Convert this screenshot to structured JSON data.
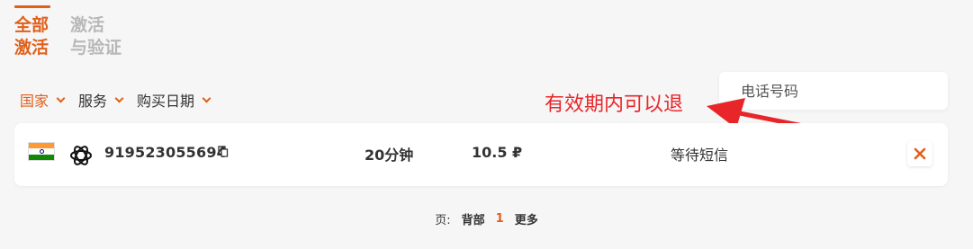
{
  "tabs": [
    {
      "label": "全部\n激活",
      "active": true
    },
    {
      "label": "激活\n与验证",
      "active": false
    }
  ],
  "filters": [
    {
      "label": "国家",
      "active": true
    },
    {
      "label": "服务",
      "active": false
    },
    {
      "label": "购买日期",
      "active": false
    }
  ],
  "phone_search": {
    "placeholder": "电话号码"
  },
  "annotation": {
    "text": "有效期内可以退",
    "color": "#e8262a"
  },
  "rows": [
    {
      "country_flag": "india-flag-icon",
      "service_icon": "openai-icon",
      "phone": "919523055694",
      "duration": "20分钟",
      "price": "10.5 ₽",
      "status": "等待短信"
    }
  ],
  "pagination": {
    "label": "页:",
    "back": "背部",
    "current": "1",
    "more": "更多"
  },
  "colors": {
    "accent": "#e0601a",
    "inactive_tab": "#b8b8b8",
    "annotation": "#e8262a"
  }
}
